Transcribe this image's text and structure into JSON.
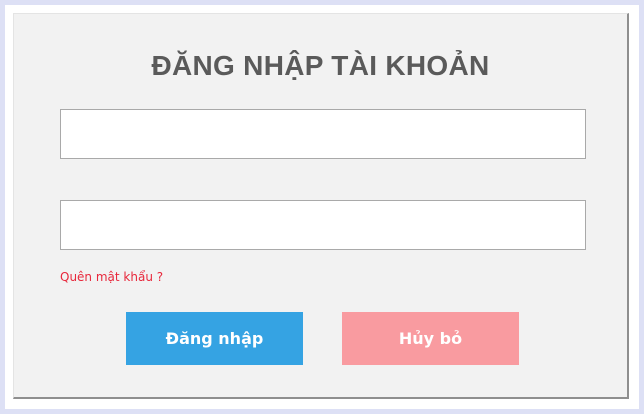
{
  "login_form": {
    "title": "ĐĂNG NHẬP TÀI KHOẢN",
    "username": {
      "value": "",
      "placeholder": ""
    },
    "password": {
      "value": "",
      "placeholder": ""
    },
    "forgot_password_label": "Quên mật khẩu ?",
    "login_button_label": "Đăng nhập",
    "cancel_button_label": "Hủy bỏ"
  },
  "colors": {
    "login_button": "#35a3e3",
    "cancel_button": "#f99ba0",
    "forgot_link": "#e8283c",
    "title": "#5a5a5a",
    "panel_background": "#f2f2f2",
    "frame_border": "#dde0f5"
  }
}
